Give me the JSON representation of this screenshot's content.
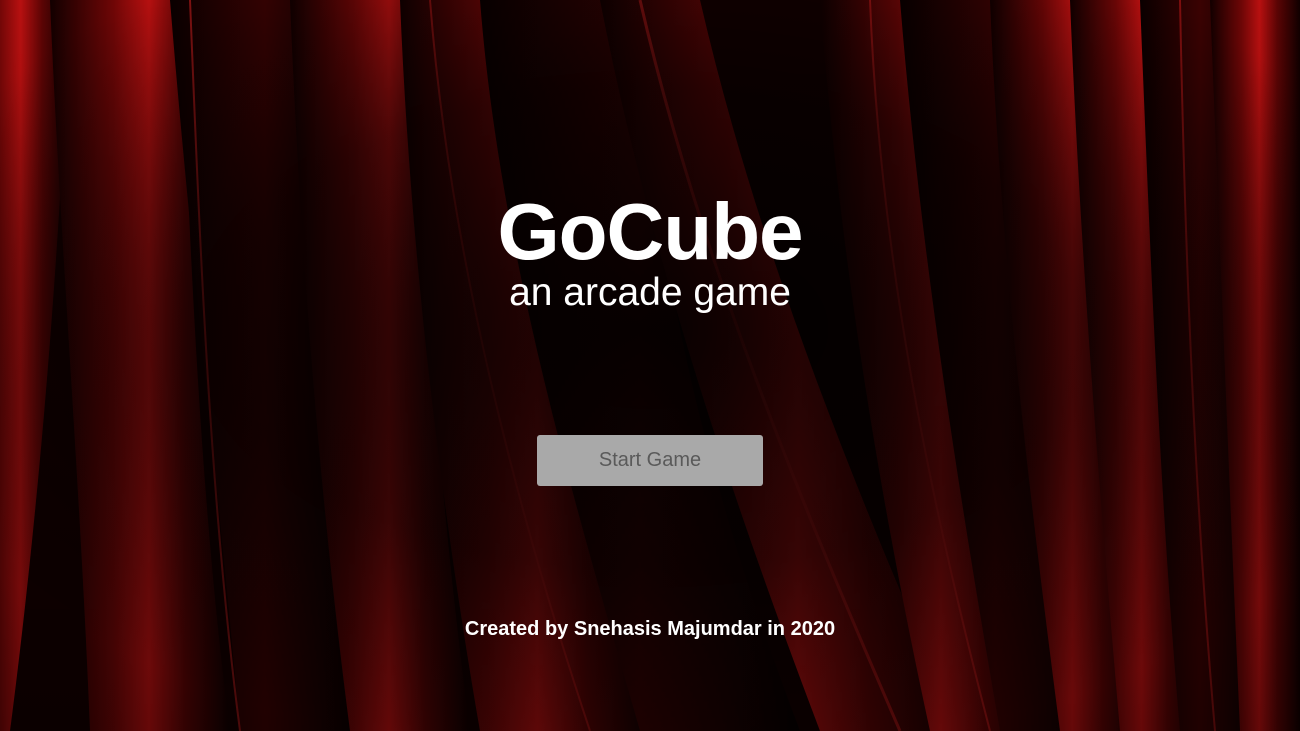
{
  "title": "GoCube",
  "subtitle": "an arcade game",
  "start_button": {
    "label": "Start Game"
  },
  "credits": "Created by Snehasis Majumdar in 2020",
  "colors": {
    "background": "#0a0000",
    "curtain_red": "#8c0a0a",
    "curtain_highlight": "#d01818",
    "text": "#ffffff",
    "button_bg": "#a9a9a9",
    "button_text": "#5a5a5a"
  },
  "background_image": "red-velvet-curtain"
}
